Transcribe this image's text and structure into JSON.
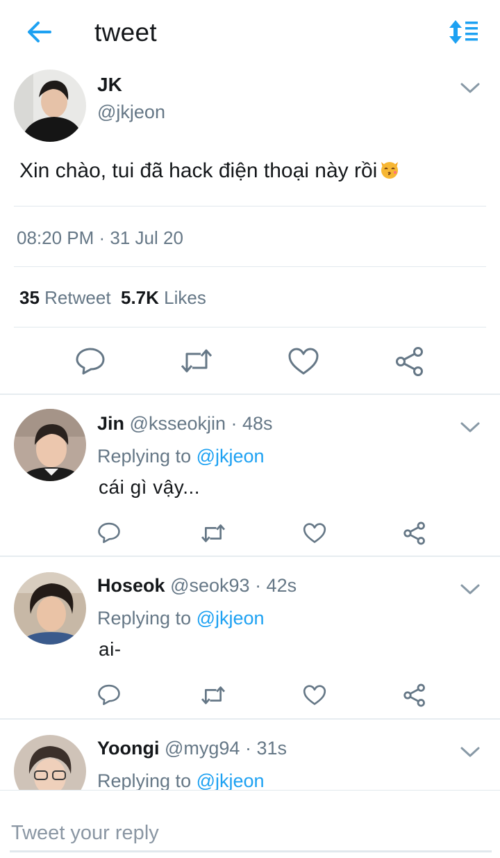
{
  "header": {
    "title": "tweet",
    "back_icon": "arrow-left-icon",
    "sort_icon": "sort-options-icon",
    "accent_color": "#1da1f2"
  },
  "main_tweet": {
    "name": "JK",
    "handle": "@jkjeon",
    "text": "Xin chào, tui đã hack điện thoại này rồi",
    "emoji": "kissing-cat-emoji",
    "timestamp": "08:20 PM · 31 Jul 20",
    "retweets_count": "35",
    "retweets_label": "Retweet",
    "likes_count": "5.7K",
    "likes_label": "Likes",
    "actions": [
      "reply-icon",
      "retweet-icon",
      "like-icon",
      "share-icon"
    ]
  },
  "replies": [
    {
      "name": "Jin",
      "handle": "@ksseokjin",
      "time": "· 48s",
      "replying_prefix": "Replying to",
      "replying_to": "@jkjeon",
      "text": "cái gì vậy..."
    },
    {
      "name": "Hoseok",
      "handle": "@seok93",
      "time": "· 42s",
      "replying_prefix": "Replying to",
      "replying_to": "@jkjeon",
      "text": "ai-"
    },
    {
      "name": "Yoongi",
      "handle": "@myg94",
      "time": "· 31s",
      "replying_prefix": "Replying to",
      "replying_to": "@jkjeon",
      "text": ""
    }
  ],
  "compose": {
    "placeholder": "Tweet your reply"
  }
}
